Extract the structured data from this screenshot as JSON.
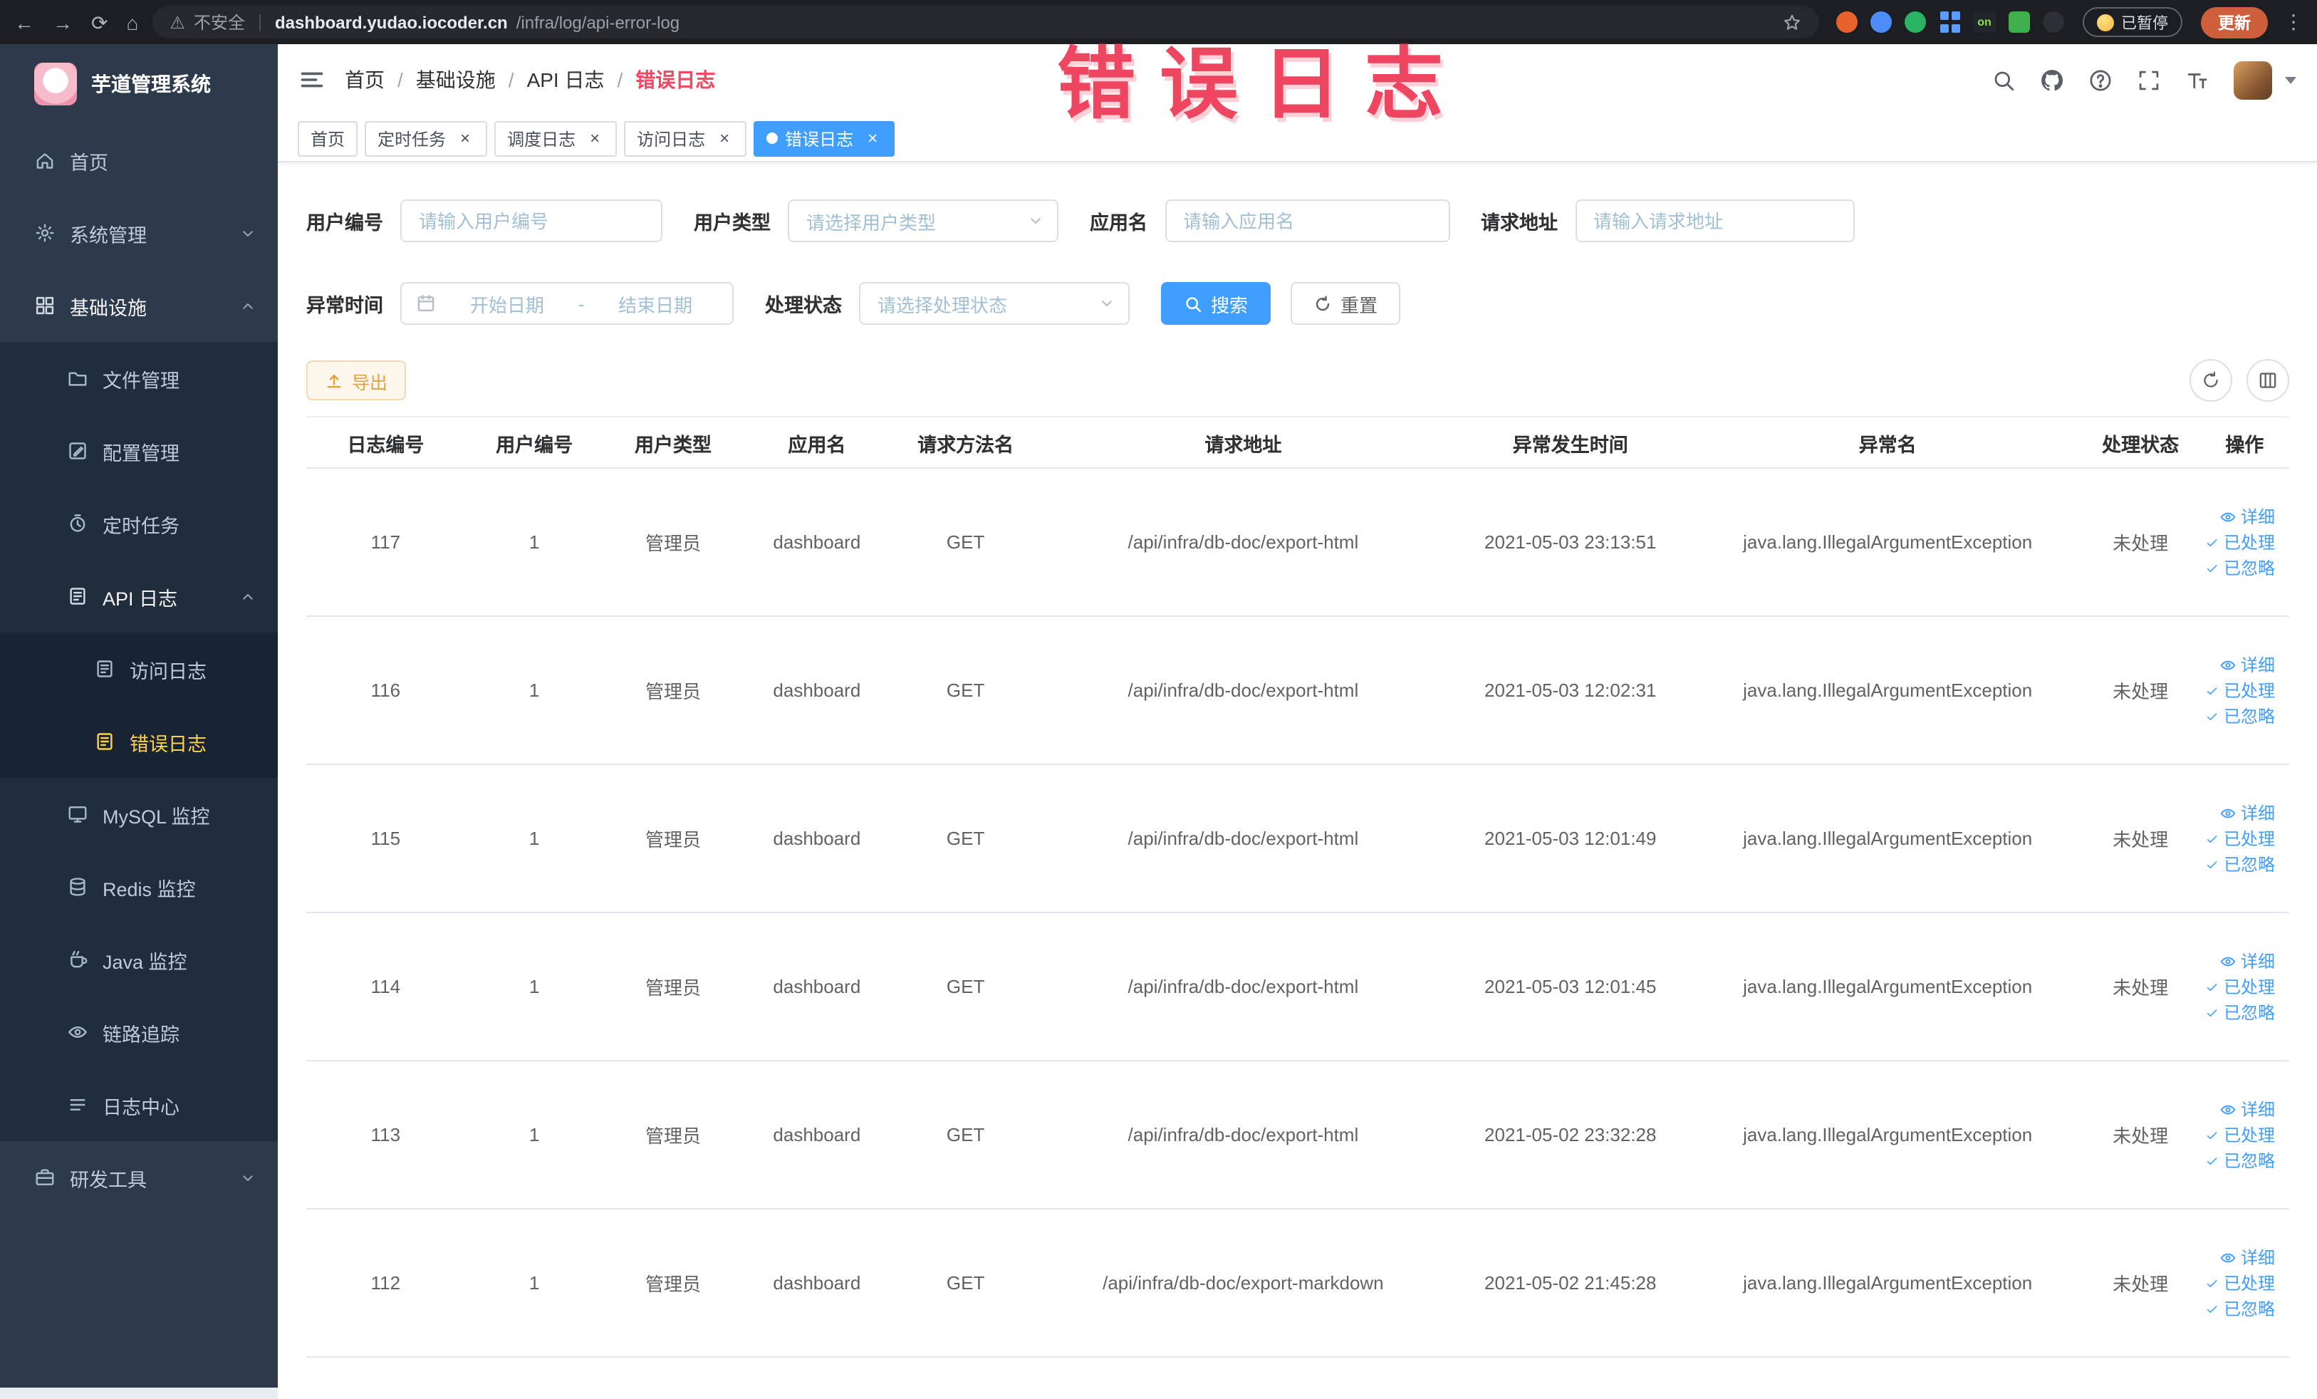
{
  "browser": {
    "security_label": "不安全",
    "url_domain": "dashboard.yudao.iocoder.cn",
    "url_path": "/infra/log/api-error-log",
    "paused_badge": "已暂停",
    "on_ext_label": "on",
    "update_button": "更新",
    "extension_icons": [
      "orange-ext-icon",
      "blue-ext-icon",
      "green-ext-icon",
      "grid-ext-icon",
      "on-ext-icon",
      "leaf-ext-icon",
      "dark-ext-icon"
    ]
  },
  "annotation": {
    "text": "错误日志"
  },
  "sidebar": {
    "logo_title": "芋道管理系统",
    "items": [
      {
        "key": "home",
        "label": "首页",
        "icon": "home-icon",
        "level": 1
      },
      {
        "key": "system-mgmt",
        "label": "系统管理",
        "icon": "gear-icon",
        "level": 1,
        "chevron": "down"
      },
      {
        "key": "infrastructure",
        "label": "基础设施",
        "icon": "grid-icon",
        "level": 1,
        "chevron": "up",
        "open": true
      },
      {
        "key": "file-mgmt",
        "label": "文件管理",
        "icon": "folder-icon",
        "level": 2
      },
      {
        "key": "config-mgmt",
        "label": "配置管理",
        "icon": "edit-icon",
        "level": 2
      },
      {
        "key": "scheduled-tasks",
        "label": "定时任务",
        "icon": "timer-icon",
        "level": 2
      },
      {
        "key": "api-logs",
        "label": "API 日志",
        "icon": "doc-edit-icon",
        "level": 2,
        "chevron": "up",
        "open": true
      },
      {
        "key": "access-log",
        "label": "访问日志",
        "icon": "doc-edit-icon",
        "level": 3
      },
      {
        "key": "error-log",
        "label": "错误日志",
        "icon": "doc-edit-icon",
        "level": 3,
        "active": true
      },
      {
        "key": "mysql-monitor",
        "label": "MySQL 监控",
        "icon": "monitor-icon",
        "level": 2
      },
      {
        "key": "redis-monitor",
        "label": "Redis 监控",
        "icon": "database-icon",
        "level": 2
      },
      {
        "key": "java-monitor",
        "label": "Java 监控",
        "icon": "coffee-icon",
        "level": 2
      },
      {
        "key": "link-tracing",
        "label": "链路追踪",
        "icon": "eye-icon",
        "level": 2
      },
      {
        "key": "log-center",
        "label": "日志中心",
        "icon": "list-icon",
        "level": 2
      },
      {
        "key": "dev-tools",
        "label": "研发工具",
        "icon": "toolbox-icon",
        "level": 1,
        "chevron": "down"
      }
    ]
  },
  "header": {
    "breadcrumb": [
      "首页",
      "基础设施",
      "API 日志",
      "错误日志"
    ],
    "icons": [
      "search-icon",
      "github-icon",
      "help-icon",
      "fullscreen-icon",
      "font-size-icon"
    ]
  },
  "tabs": [
    {
      "key": "home",
      "label": "首页",
      "closable": false,
      "active": false
    },
    {
      "key": "scheduled-tasks",
      "label": "定时任务",
      "closable": true,
      "active": false
    },
    {
      "key": "schedule-log",
      "label": "调度日志",
      "closable": true,
      "active": false
    },
    {
      "key": "access-log",
      "label": "访问日志",
      "closable": true,
      "active": false
    },
    {
      "key": "error-log",
      "label": "错误日志",
      "closable": true,
      "active": true
    }
  ],
  "filters": {
    "user_id": {
      "label": "用户编号",
      "placeholder": "请输入用户编号"
    },
    "user_type": {
      "label": "用户类型",
      "placeholder": "请选择用户类型"
    },
    "app_name": {
      "label": "应用名",
      "placeholder": "请输入应用名"
    },
    "request_url": {
      "label": "请求地址",
      "placeholder": "请输入请求地址"
    },
    "exception_time": {
      "label": "异常时间",
      "start_placeholder": "开始日期",
      "separator": "-",
      "end_placeholder": "结束日期"
    },
    "process_status": {
      "label": "处理状态",
      "placeholder": "请选择处理状态"
    },
    "search_button": "搜索",
    "reset_button": "重置"
  },
  "toolbar": {
    "export_button": "导出",
    "icons": [
      "refresh-icon",
      "columns-icon"
    ]
  },
  "table": {
    "columns": [
      "日志编号",
      "用户编号",
      "用户类型",
      "应用名",
      "请求方法名",
      "请求地址",
      "异常发生时间",
      "异常名",
      "处理状态",
      "操作"
    ],
    "actions": [
      "详细",
      "已处理",
      "已忽略"
    ],
    "rows": [
      {
        "id": "117",
        "user_id": "1",
        "user_type": "管理员",
        "app": "dashboard",
        "method": "GET",
        "url": "/api/infra/db-doc/export-html",
        "time": "2021-05-03 23:13:51",
        "exception": "java.lang.IllegalArgumentException",
        "status": "未处理"
      },
      {
        "id": "116",
        "user_id": "1",
        "user_type": "管理员",
        "app": "dashboard",
        "method": "GET",
        "url": "/api/infra/db-doc/export-html",
        "time": "2021-05-03 12:02:31",
        "exception": "java.lang.IllegalArgumentException",
        "status": "未处理"
      },
      {
        "id": "115",
        "user_id": "1",
        "user_type": "管理员",
        "app": "dashboard",
        "method": "GET",
        "url": "/api/infra/db-doc/export-html",
        "time": "2021-05-03 12:01:49",
        "exception": "java.lang.IllegalArgumentException",
        "status": "未处理"
      },
      {
        "id": "114",
        "user_id": "1",
        "user_type": "管理员",
        "app": "dashboard",
        "method": "GET",
        "url": "/api/infra/db-doc/export-html",
        "time": "2021-05-03 12:01:45",
        "exception": "java.lang.IllegalArgumentException",
        "status": "未处理"
      },
      {
        "id": "113",
        "user_id": "1",
        "user_type": "管理员",
        "app": "dashboard",
        "method": "GET",
        "url": "/api/infra/db-doc/export-html",
        "time": "2021-05-02 23:32:28",
        "exception": "java.lang.IllegalArgumentException",
        "status": "未处理"
      },
      {
        "id": "112",
        "user_id": "1",
        "user_type": "管理员",
        "app": "dashboard",
        "method": "GET",
        "url": "/api/infra/db-doc/export-markdown",
        "time": "2021-05-02 21:45:28",
        "exception": "java.lang.IllegalArgumentException",
        "status": "未处理"
      }
    ]
  }
}
